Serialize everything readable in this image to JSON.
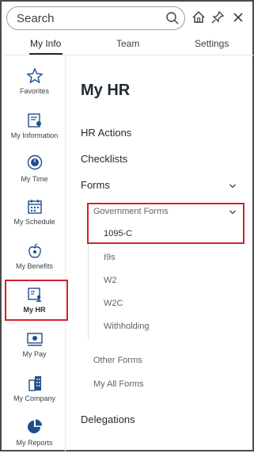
{
  "search": {
    "placeholder": "Search"
  },
  "tabs": [
    {
      "label": "My Info",
      "active": true
    },
    {
      "label": "Team",
      "active": false
    },
    {
      "label": "Settings",
      "active": false
    }
  ],
  "sidebar": {
    "items": [
      {
        "label": "Favorites",
        "icon": "star-icon"
      },
      {
        "label": "My Information",
        "icon": "id-card-icon"
      },
      {
        "label": "My Time",
        "icon": "clock-icon"
      },
      {
        "label": "My Schedule",
        "icon": "calendar-icon"
      },
      {
        "label": "My Benefits",
        "icon": "apple-icon"
      },
      {
        "label": "My HR",
        "icon": "hr-document-icon",
        "active": true
      },
      {
        "label": "My Pay",
        "icon": "pay-icon"
      },
      {
        "label": "My Company",
        "icon": "building-icon"
      },
      {
        "label": "My Reports",
        "icon": "pie-chart-icon"
      }
    ]
  },
  "main": {
    "title": "My HR",
    "nav": [
      {
        "label": "HR Actions"
      },
      {
        "label": "Checklists"
      },
      {
        "label": "Forms",
        "expanded": true
      },
      {
        "label": "Delegations"
      }
    ],
    "forms_children": [
      {
        "label": "Government Forms",
        "expanded": true
      },
      {
        "label": "Other Forms"
      },
      {
        "label": "My All Forms"
      }
    ],
    "government_forms": [
      {
        "label": "1095-C"
      },
      {
        "label": "I9s"
      },
      {
        "label": "W2"
      },
      {
        "label": "W2C"
      },
      {
        "label": "Withholding"
      }
    ]
  },
  "colors": {
    "highlight": "#d6202a",
    "accent": "#1f4e8c"
  }
}
